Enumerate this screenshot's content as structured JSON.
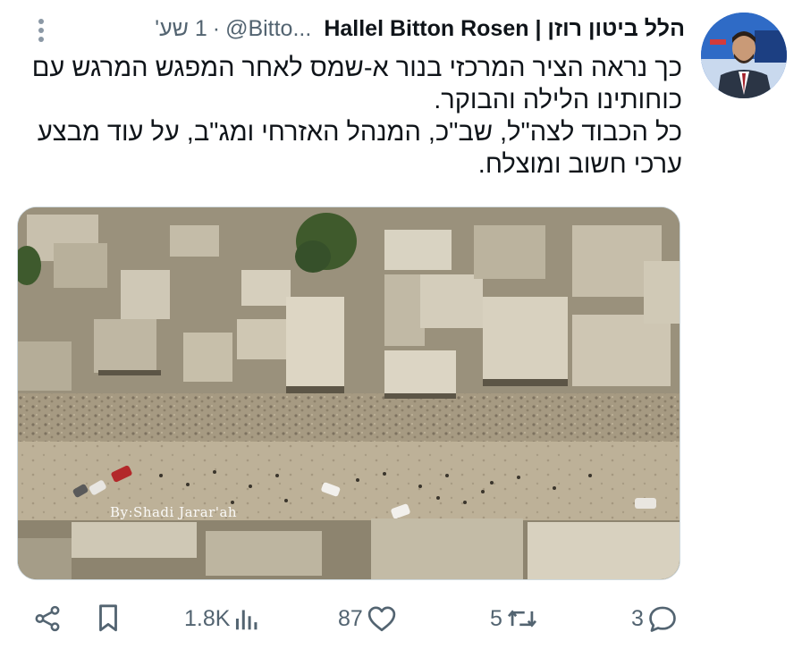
{
  "tweet": {
    "author_name_hebrew": "הלל ביטון רוזן",
    "author_name_separator": "|",
    "author_name_english": "Hallel Bitton Rosen",
    "handle": "@Bitto...",
    "separator": "·",
    "time": "1 שע'",
    "text_lines": [
      "כך נראה הציר המרכזי בנור א-שמס לאחר המפגש המרגש עם כוחותינו הלילה והבוקר.",
      "כל הכבוד לצה\"ל, שב\"כ, המנהל האזרחי ומג\"ב, על עוד מבצע ערכי חשוב ומוצלח."
    ],
    "media": {
      "watermark": "By:Shadi Jarar'ah"
    }
  },
  "actions": {
    "replies": "3",
    "reposts": "5",
    "likes": "87",
    "views": "1.8K"
  },
  "icons": {
    "more": "more-vertical-icon",
    "reply": "reply-icon",
    "repost": "repost-icon",
    "like": "heart-icon",
    "views": "views-icon",
    "bookmark": "bookmark-icon",
    "share": "share-icon"
  }
}
